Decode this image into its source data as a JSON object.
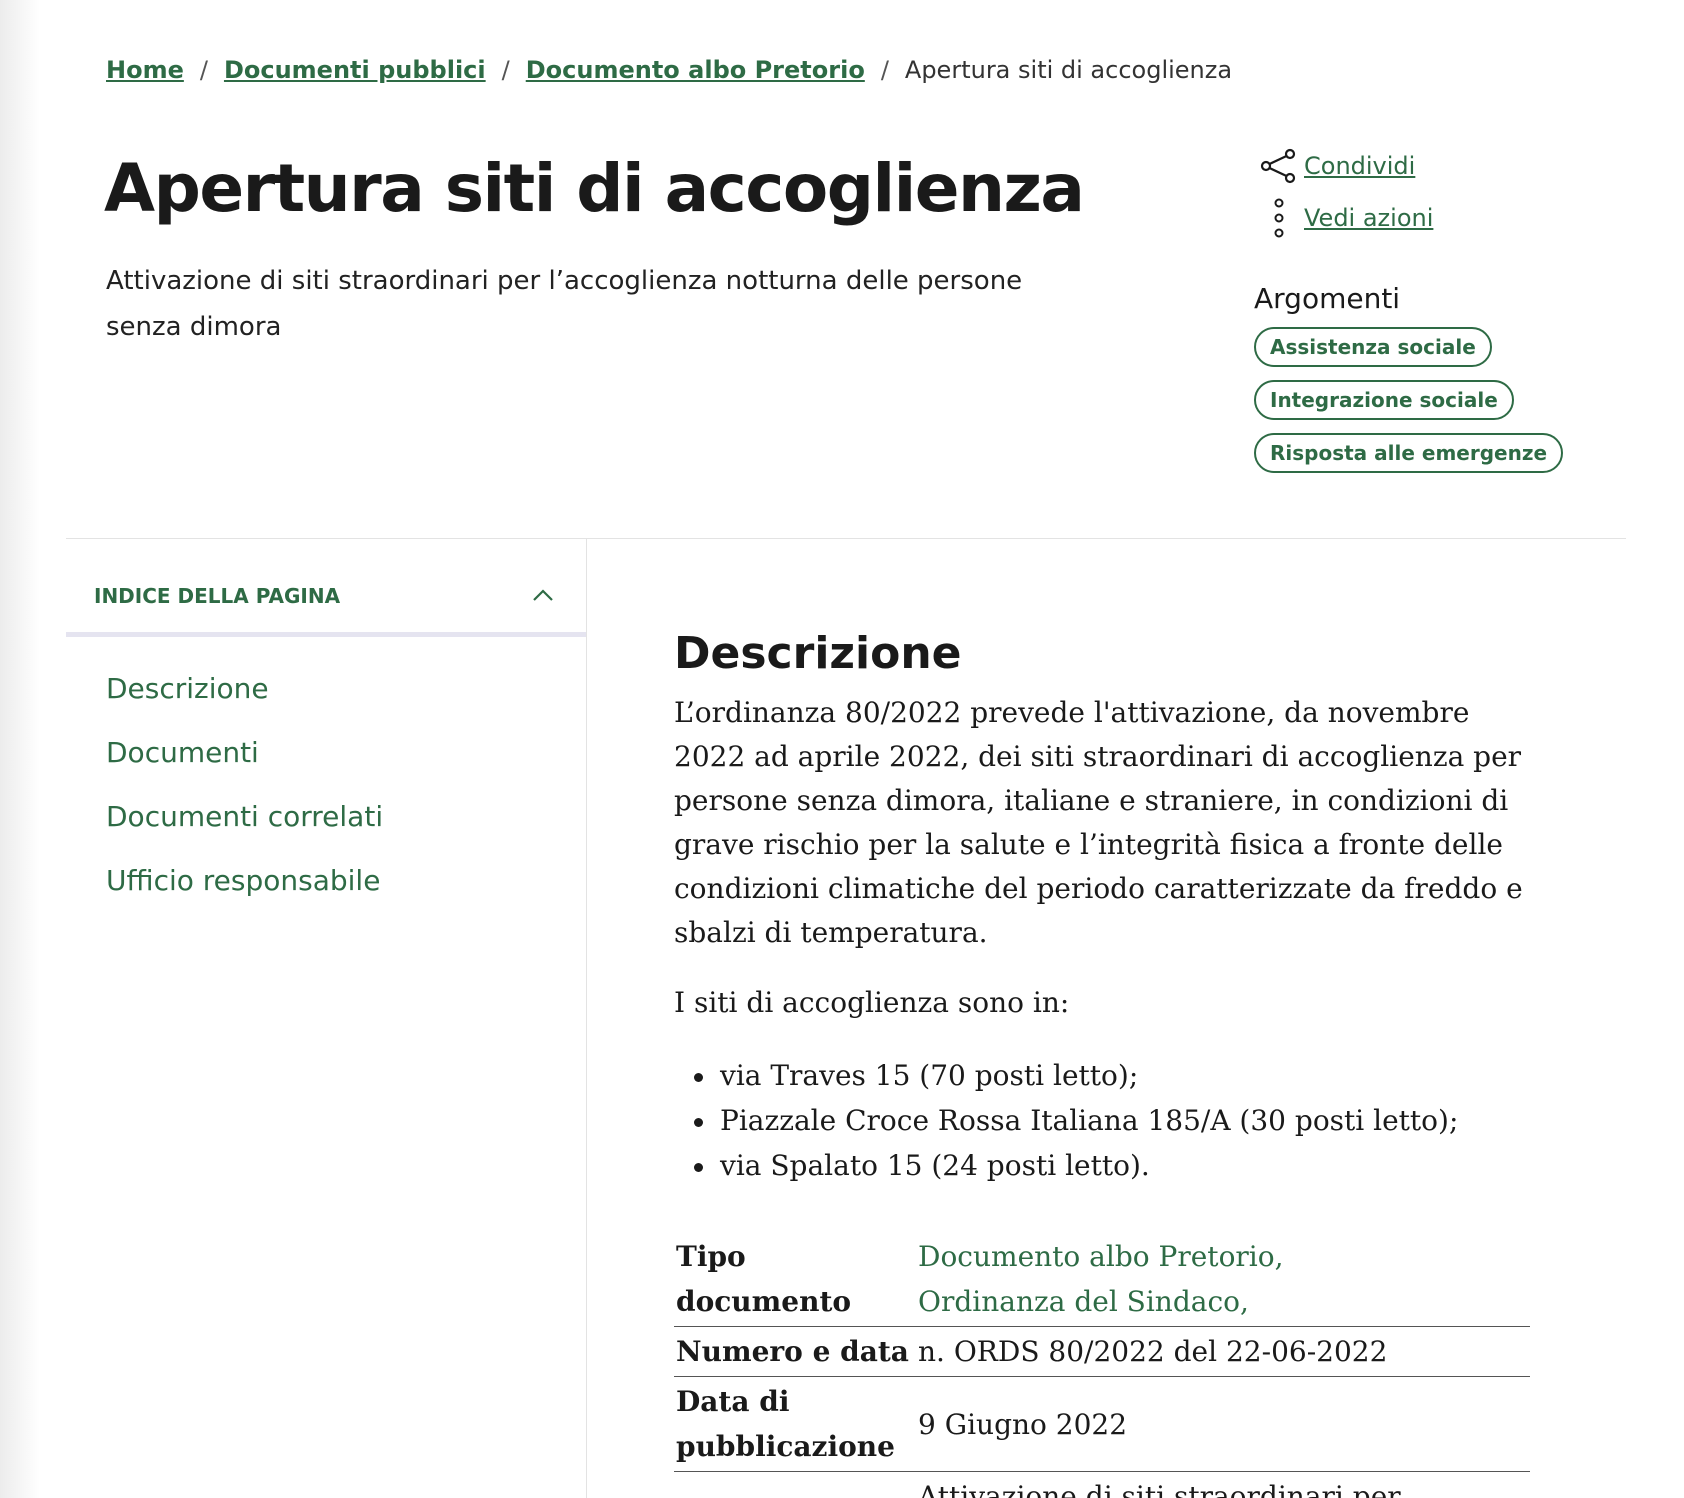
{
  "breadcrumb": {
    "home": "Home",
    "documenti_pubblici": "Documenti pubblici",
    "documento_albo": "Documento albo Pretorio",
    "current": "Apertura siti di accoglienza",
    "separator": "/"
  },
  "header": {
    "title": "Apertura siti di accoglienza",
    "subtitle": "Attivazione di siti straordinari per l’accoglienza notturna delle persone senza dimora"
  },
  "actions": {
    "share_label": "Condividi",
    "more_label": "Vedi azioni"
  },
  "argomenti": {
    "title": "Argomenti",
    "tags": [
      "Assistenza sociale",
      "Integrazione sociale",
      "Risposta alle emergenze"
    ]
  },
  "toc": {
    "title": "INDICE DELLA PAGINA",
    "items": [
      "Descrizione",
      "Documenti",
      "Documenti correlati",
      "Ufficio responsabile"
    ]
  },
  "description": {
    "title": "Descrizione",
    "paragraph": "L’ordinanza 80/2022 prevede l'attivazione, da novembre 2022 ad aprile 2022, dei siti straordinari di accoglienza per persone senza dimora, italiane e straniere, in condizioni di grave rischio per la salute e l’integrità fisica a fronte delle condizioni climatiche del periodo caratterizzate da freddo e sbalzi di temperatura.",
    "sites_intro": "I siti di accoglienza sono in:",
    "sites": [
      "via Traves 15 (70 posti letto);",
      "Piazzale Croce Rossa Italiana 185/A (30 posti letto);",
      "via Spalato 15 (24 posti letto)."
    ]
  },
  "info_table": {
    "tipo_label": "Tipo documento",
    "tipo_values": [
      "Documento albo Pretorio,",
      "Ordinanza del Sindaco,"
    ],
    "numero_label": "Numero e data",
    "numero_value": "n. ORDS 80/2022 del 22-06-2022",
    "pubblicazione_label": "Data di pubblicazione",
    "pubblicazione_value": "9 Giugno 2022",
    "next_value_partial": "Attivazione di siti straordinari per"
  },
  "colors": {
    "accent": "#2e6b45",
    "text": "#1a1a1a",
    "divider": "#e3e3e3"
  }
}
